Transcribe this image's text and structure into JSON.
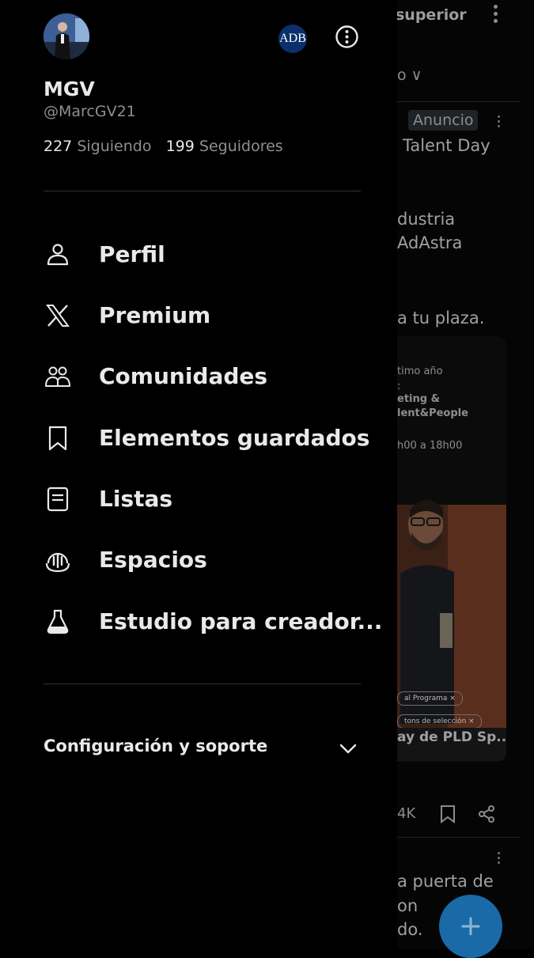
{
  "background_feed": {
    "header_title_fragment": "superior",
    "tab_fragment": "o ∨",
    "ad_badge": "Anuncio",
    "post_lines": [
      "Talent Day",
      "dustria",
      "AdAstra",
      "a tu plaza."
    ],
    "card_lines": [
      "timo año",
      ":",
      "eting &",
      "lent&People",
      "h00 a 18h00"
    ],
    "card_pills": [
      "al Programa ×",
      "tons de selección ×"
    ],
    "card_caption": "ay de PLD Sp...",
    "views_fragment": "4K",
    "next_post_lines": [
      "a puerta de",
      "on",
      "do."
    ]
  },
  "drawer": {
    "avatar_icon": "profile-photo",
    "badge_text": "ADB",
    "user": {
      "name": "MGV",
      "handle": "@MarcGV21"
    },
    "stats": {
      "following_count": "227",
      "following_label": "Siguiendo",
      "followers_count": "199",
      "followers_label": "Seguidores"
    },
    "menu": [
      {
        "label": "Perfil",
        "icon": "person-icon"
      },
      {
        "label": "Premium",
        "icon": "x-logo-icon"
      },
      {
        "label": "Comunidades",
        "icon": "communities-icon"
      },
      {
        "label": "Elementos guardados",
        "icon": "bookmark-icon"
      },
      {
        "label": "Listas",
        "icon": "list-icon"
      },
      {
        "label": "Espacios",
        "icon": "spaces-icon"
      },
      {
        "label": "Estudio para creador...",
        "icon": "flask-icon"
      }
    ],
    "settings_label": "Configuración y soporte"
  },
  "colors": {
    "text_primary": "#e7e9ea",
    "text_secondary": "#8b8f93",
    "divider": "#2f3336",
    "fab": "#1a6aa8",
    "badge_bg": "#0b2f6b"
  }
}
